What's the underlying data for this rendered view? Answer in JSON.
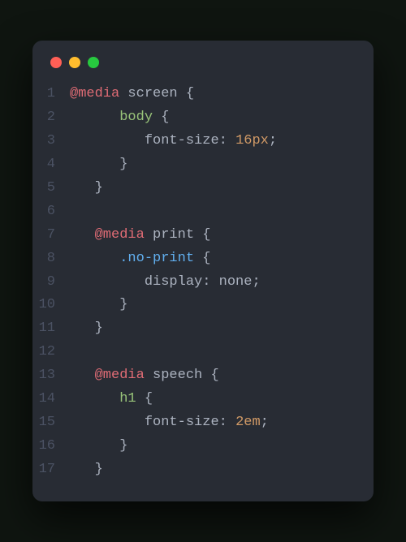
{
  "window": {
    "controls": [
      "close",
      "minimize",
      "maximize"
    ]
  },
  "code": {
    "lines": [
      {
        "num": "1",
        "indent": 0,
        "tokens": [
          [
            "keyword",
            "@media"
          ],
          [
            "space",
            " "
          ],
          [
            "ident",
            "screen"
          ],
          [
            "space",
            " "
          ],
          [
            "brace",
            "{"
          ]
        ]
      },
      {
        "num": "2",
        "indent": 2,
        "tokens": [
          [
            "tag",
            "body"
          ],
          [
            "space",
            " "
          ],
          [
            "brace",
            "{"
          ]
        ]
      },
      {
        "num": "3",
        "indent": 3,
        "tokens": [
          [
            "prop",
            "font-size"
          ],
          [
            "punct",
            ":"
          ],
          [
            "space",
            " "
          ],
          [
            "value",
            "16px"
          ],
          [
            "punct",
            ";"
          ]
        ]
      },
      {
        "num": "4",
        "indent": 2,
        "tokens": [
          [
            "brace",
            "}"
          ]
        ]
      },
      {
        "num": "5",
        "indent": 1,
        "tokens": [
          [
            "brace",
            "}"
          ]
        ]
      },
      {
        "num": "6",
        "indent": 0,
        "tokens": []
      },
      {
        "num": "7",
        "indent": 1,
        "tokens": [
          [
            "keyword",
            "@media"
          ],
          [
            "space",
            " "
          ],
          [
            "ident",
            "print"
          ],
          [
            "space",
            " "
          ],
          [
            "brace",
            "{"
          ]
        ]
      },
      {
        "num": "8",
        "indent": 2,
        "tokens": [
          [
            "class",
            ".no-print"
          ],
          [
            "space",
            " "
          ],
          [
            "brace",
            "{"
          ]
        ]
      },
      {
        "num": "9",
        "indent": 3,
        "tokens": [
          [
            "prop",
            "display"
          ],
          [
            "punct",
            ":"
          ],
          [
            "space",
            " "
          ],
          [
            "ident",
            "none"
          ],
          [
            "punct",
            ";"
          ]
        ]
      },
      {
        "num": "10",
        "indent": 2,
        "tokens": [
          [
            "brace",
            "}"
          ]
        ]
      },
      {
        "num": "11",
        "indent": 1,
        "tokens": [
          [
            "brace",
            "}"
          ]
        ]
      },
      {
        "num": "12",
        "indent": 0,
        "tokens": []
      },
      {
        "num": "13",
        "indent": 1,
        "tokens": [
          [
            "keyword",
            "@media"
          ],
          [
            "space",
            " "
          ],
          [
            "ident",
            "speech"
          ],
          [
            "space",
            " "
          ],
          [
            "brace",
            "{"
          ]
        ]
      },
      {
        "num": "14",
        "indent": 2,
        "tokens": [
          [
            "tag",
            "h1"
          ],
          [
            "space",
            " "
          ],
          [
            "brace",
            "{"
          ]
        ]
      },
      {
        "num": "15",
        "indent": 3,
        "tokens": [
          [
            "prop",
            "font-size"
          ],
          [
            "punct",
            ":"
          ],
          [
            "space",
            " "
          ],
          [
            "value",
            "2em"
          ],
          [
            "punct",
            ";"
          ]
        ]
      },
      {
        "num": "16",
        "indent": 2,
        "tokens": [
          [
            "brace",
            "}"
          ]
        ]
      },
      {
        "num": "17",
        "indent": 1,
        "tokens": [
          [
            "brace",
            "}"
          ]
        ]
      }
    ]
  }
}
